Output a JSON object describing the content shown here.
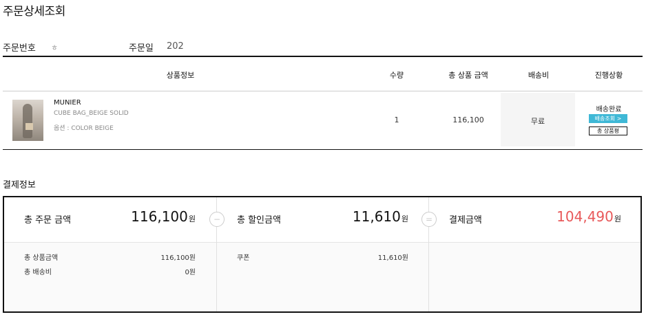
{
  "page": {
    "title": "주문상세조회"
  },
  "order_meta": {
    "order_no_label": "주문번호",
    "order_no_value": "ㅎ",
    "order_date_label": "주문일",
    "order_date_value": "202"
  },
  "table": {
    "headers": [
      "상품정보",
      "수량",
      "총 상품 금액",
      "배송비",
      "진행상황"
    ],
    "item": {
      "brand": "MUNIER",
      "name": "CUBE BAG_BEIGE SOLID",
      "option": "옵션 : COLOR BEIGE",
      "qty": "1",
      "total": "116,100",
      "shipping": "무료",
      "status": "배송완료",
      "track_button": "배송조회 >",
      "review_button": "총 상품평"
    }
  },
  "payment": {
    "section_title": "결제정보",
    "order_total": {
      "label": "총 주문 금액",
      "amount": "116,100",
      "unit": "원"
    },
    "discount_total": {
      "label": "총 할인금액",
      "amount": "11,610",
      "unit": "원"
    },
    "pay_total": {
      "label": "결제금액",
      "amount": "104,490",
      "unit": "원"
    },
    "op_minus": "−",
    "op_equals": "=",
    "details_left": [
      {
        "label": "총 상품금액",
        "value": "116,100원"
      },
      {
        "label": "총 배송비",
        "value": "0원"
      }
    ],
    "details_mid": [
      {
        "label": "쿠폰",
        "value": "11,610원"
      }
    ]
  },
  "colors": {
    "accent_blue": "#3fb8d6",
    "pay_red": "#e8595a"
  }
}
